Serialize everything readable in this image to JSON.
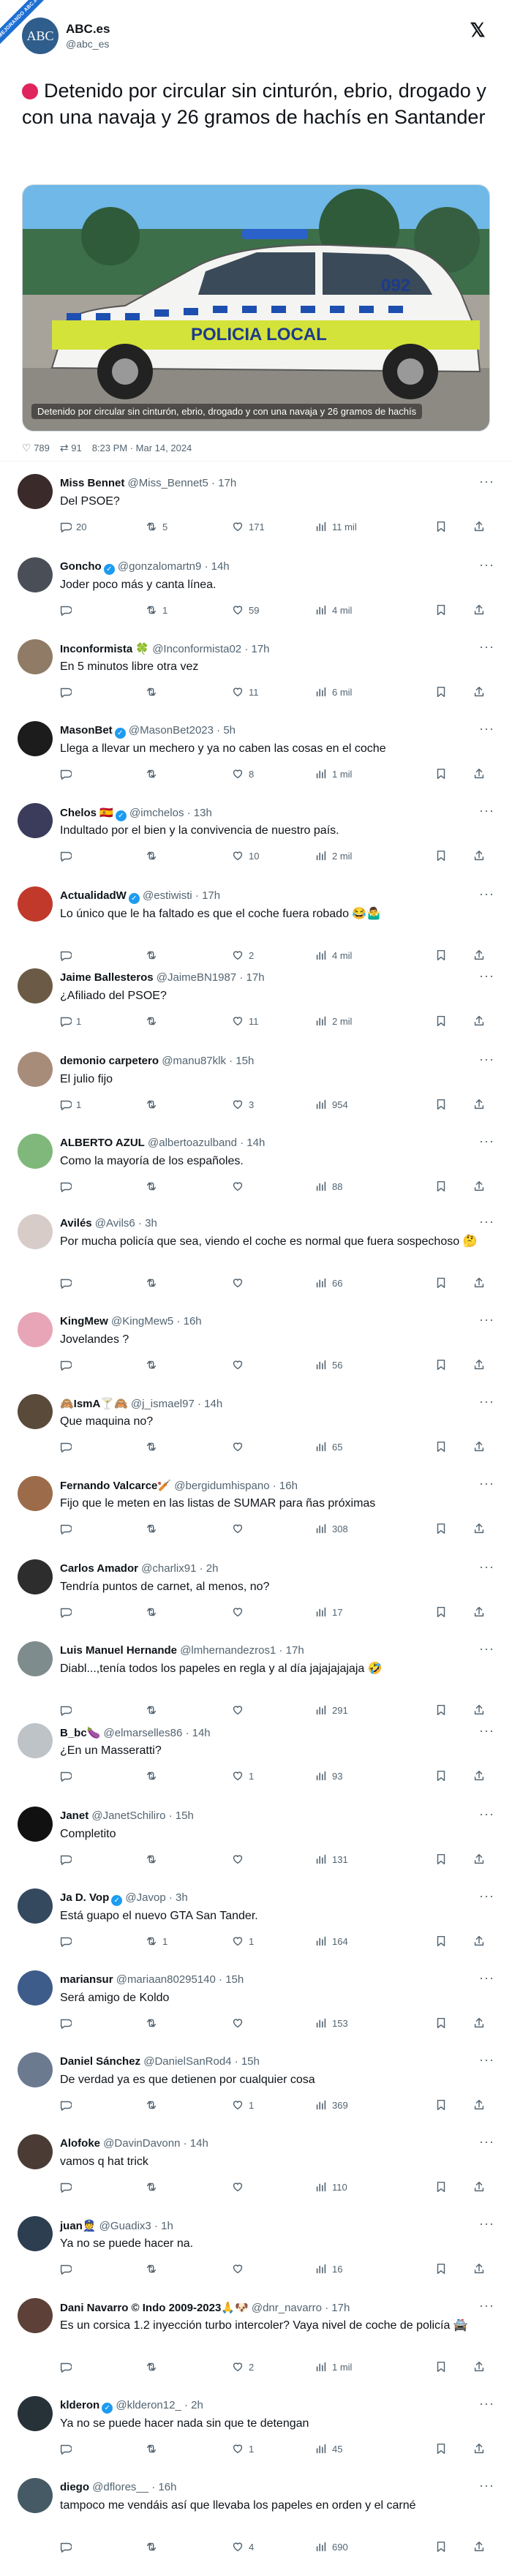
{
  "ribbon": "MEJORANDO ABC.es",
  "post": {
    "author_name": "ABC.es",
    "author_handle": "@abc_es",
    "avatar_text": "ABC",
    "title": "Detenido por circular sin cinturón, ebrio, drogado y con una navaja y 26 gramos de hachís en Santander",
    "image_caption": "Detenido por circular sin cinturón, ebrio, drogado y con una navaja y 26 gramos de hachís",
    "car_door_text": "POLICIA LOCAL",
    "car_number": "092",
    "likes": "789",
    "reposts": "91",
    "timestamp": "8:23 PM · Mar 14, 2024"
  },
  "replies": [
    {
      "name": "Miss Bennet",
      "handle": "@Miss_Bennet5 · 17h",
      "text": "Del PSOE?",
      "replies": "20",
      "reposts": "5",
      "likes": "171",
      "views": "11 mil",
      "verified": false,
      "avatar": "#3a2a2a"
    },
    {
      "name": "Goncho",
      "handle": "@gonzalomartn9 · 14h",
      "text": "Joder poco más y canta línea.",
      "replies": "",
      "reposts": "1",
      "likes": "59",
      "views": "4 mil",
      "verified": true,
      "avatar": "#4a4f57"
    },
    {
      "name": "Inconformista 🍀",
      "handle": "@Inconformista02 · 17h",
      "text": "En 5 minutos libre otra vez",
      "replies": "",
      "reposts": "",
      "likes": "11",
      "views": "6 mil",
      "verified": false,
      "avatar": "#8f7b66"
    },
    {
      "name": "MasonBet",
      "handle": "@MasonBet2023 · 5h",
      "text": "Llega a llevar un mechero y ya no caben las cosas en el coche",
      "replies": "",
      "reposts": "",
      "likes": "8",
      "views": "1 mil",
      "verified": true,
      "avatar": "#1c1c1c"
    },
    {
      "name": "Chelos 🇪🇸",
      "handle": "@imchelos · 13h",
      "text": "Indultado por el bien y la convivencia de nuestro país.",
      "replies": "",
      "reposts": "",
      "likes": "10",
      "views": "2 mil",
      "verified": true,
      "avatar": "#3b3b5c"
    },
    {
      "name": "ActualidadW",
      "handle": "@estiwisti · 17h",
      "text": "Lo único que le ha faltado es que el coche fuera robado 😂🤷‍♂️",
      "replies": "",
      "reposts": "",
      "likes": "2",
      "views": "4 mil",
      "verified": true,
      "avatar": "#c0392b"
    },
    {
      "name": "Jaime Ballesteros",
      "handle": "@JaimeBN1987 · 17h",
      "text": "¿Afiliado del PSOE?",
      "replies": "1",
      "reposts": "",
      "likes": "11",
      "views": "2 mil",
      "verified": false,
      "avatar": "#6b5a45"
    },
    {
      "name": "demonio carpetero",
      "handle": "@manu87klk · 15h",
      "text": "El julio fijo",
      "replies": "1",
      "reposts": "",
      "likes": "3",
      "views": "954",
      "verified": false,
      "avatar": "#a88c7a"
    },
    {
      "name": "ALBERTO AZUL",
      "handle": "@albertoazulband · 14h",
      "text": "Como la mayoría de los españoles.",
      "replies": "",
      "reposts": "",
      "likes": "",
      "views": "88",
      "verified": false,
      "avatar": "#7fb87a"
    },
    {
      "name": "Avilés",
      "handle": "@Avils6 · 3h",
      "text": "Por mucha policía que sea, viendo el coche es normal que fuera sospechoso 🤔",
      "replies": "",
      "reposts": "",
      "likes": "",
      "views": "66",
      "verified": false,
      "avatar": "#d7ccc8"
    },
    {
      "name": "KingMew",
      "handle": "@KingMew5 · 16h",
      "text": "Jovelandes ?",
      "replies": "",
      "reposts": "",
      "likes": "",
      "views": "56",
      "verified": false,
      "avatar": "#e8a5b8"
    },
    {
      "name": "🙈IsmA🍸🙈",
      "handle": "@j_ismael97 · 14h",
      "text": "Que maquina no?",
      "replies": "",
      "reposts": "",
      "likes": "",
      "views": "65",
      "verified": false,
      "avatar": "#5a4a3a"
    },
    {
      "name": "Fernando Valcarce🏏",
      "handle": "@bergidumhispano · 16h",
      "text": "Fijo que le meten en las listas de SUMAR para ñas próximas",
      "replies": "",
      "reposts": "",
      "likes": "",
      "views": "308",
      "verified": false,
      "avatar": "#9c6b4a"
    },
    {
      "name": "Carlos Amador",
      "handle": "@charlix91 · 2h",
      "text": "Tendría puntos de carnet, al menos, no?",
      "replies": "",
      "reposts": "",
      "likes": "",
      "views": "17",
      "verified": false,
      "avatar": "#2d2d2d"
    },
    {
      "name": "Luis Manuel Hernande",
      "handle": "@lmhernandezros1 · 17h",
      "text": "Diabl...,tenía todos los papeles en regla y al día jajajajajaja 🤣",
      "replies": "",
      "reposts": "",
      "likes": "",
      "views": "291",
      "verified": false,
      "avatar": "#7f8c8d"
    },
    {
      "name": "B_bc🍆",
      "handle": "@elmarselles86 · 14h",
      "text": "¿En un Masseratti?",
      "replies": "",
      "reposts": "",
      "likes": "1",
      "views": "93",
      "verified": false,
      "avatar": "#bdc3c7"
    },
    {
      "name": "Janet",
      "handle": "@JanetSchiliro · 15h",
      "text": "Completito",
      "replies": "",
      "reposts": "",
      "likes": "",
      "views": "131",
      "verified": false,
      "avatar": "#111111"
    },
    {
      "name": "Ja D. Vop",
      "handle": "@Javop · 3h",
      "text": "Está guapo el nuevo GTA San Tander.",
      "replies": "",
      "reposts": "1",
      "likes": "1",
      "views": "164",
      "verified": true,
      "avatar": "#34495e"
    },
    {
      "name": "mariansur",
      "handle": "@mariaan80295140 · 15h",
      "text": "Será amigo de Koldo",
      "replies": "",
      "reposts": "",
      "likes": "",
      "views": "153",
      "verified": false,
      "avatar": "#3e5c8a"
    },
    {
      "name": "Daniel Sánchez",
      "handle": "@DanielSanRod4 · 15h",
      "text": "De verdad ya es que detienen por cualquier cosa",
      "replies": "",
      "reposts": "",
      "likes": "1",
      "views": "369",
      "verified": false,
      "avatar": "#6b7a8f"
    },
    {
      "name": "Alofoke",
      "handle": "@DavinDavonn · 14h",
      "text": "vamos q hat trick",
      "replies": "",
      "reposts": "",
      "likes": "",
      "views": "110",
      "verified": false,
      "avatar": "#4a3c35"
    },
    {
      "name": "juan👮",
      "handle": "@Guadix3 · 1h",
      "text": "Ya no se puede hacer na.",
      "replies": "",
      "reposts": "",
      "likes": "",
      "views": "16",
      "verified": false,
      "avatar": "#2c3e50"
    },
    {
      "name": "Dani Navarro © Indo 2009-2023🙏🐶",
      "handle": "@dnr_navarro · 17h",
      "text": "Es un corsica 1.2 inyección turbo intercoler? Vaya nivel de coche de policía 🚔",
      "replies": "",
      "reposts": "",
      "likes": "2",
      "views": "1 mil",
      "verified": false,
      "avatar": "#5d4037"
    },
    {
      "name": "klderon",
      "handle": "@klderon12_ · 2h",
      "text": "Ya no se puede hacer nada sin que te detengan",
      "replies": "",
      "reposts": "",
      "likes": "1",
      "views": "45",
      "verified": true,
      "avatar": "#263238"
    },
    {
      "name": "diego",
      "handle": "@dflores__ · 16h",
      "text": "tampoco me vendáis así que llevaba los papeles en orden y el carné",
      "replies": "",
      "reposts": "",
      "likes": "4",
      "views": "690",
      "verified": false,
      "avatar": "#455a64"
    }
  ]
}
